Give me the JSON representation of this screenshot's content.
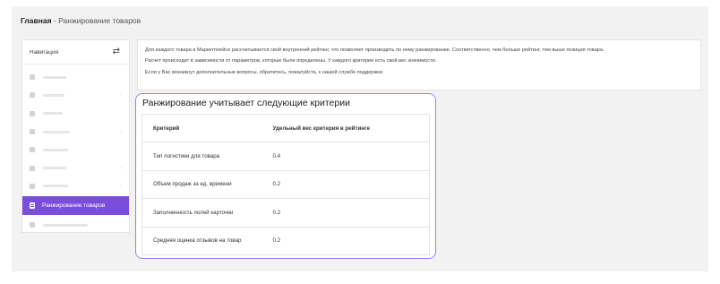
{
  "breadcrumb": {
    "home": "Главная",
    "separator": " - ",
    "current": "Ранжирование товаров"
  },
  "sidebar": {
    "title": "Навигация",
    "toggle_icon": "swap-arrows-icon",
    "items": [
      {
        "icon": "home-icon",
        "has_chevron": false,
        "active": false
      },
      {
        "icon": "box-icon",
        "has_chevron": true,
        "active": false
      },
      {
        "icon": "filter-icon",
        "has_chevron": false,
        "active": false
      },
      {
        "icon": "folder-icon",
        "has_chevron": true,
        "active": false
      },
      {
        "icon": "percent-icon",
        "has_chevron": false,
        "active": false
      },
      {
        "icon": "chart-icon",
        "has_chevron": true,
        "active": false
      },
      {
        "icon": "grid-icon",
        "has_chevron": true,
        "active": false
      },
      {
        "icon": "document-icon",
        "label": "Ранжирование товаров",
        "active": true
      },
      {
        "icon": "wrench-icon",
        "has_chevron": false,
        "active": false
      }
    ]
  },
  "info": {
    "line1": "Для каждого товара в Маркетплейсе рассчитывается свой внутренний рейтинг, что позволяет производить по нему ранжирование. Соответственно, чем больше рейтинг, тем выше позиция товара.",
    "line2": "Расчет происходит в зависимости от параметров, которые были определены. У каждого критерия есть свой вес значимости.",
    "line3": "Если у Вас возникнут дополнительные вопросы, обратитесь, пожалуйста, к нашей службе поддержки."
  },
  "criteria": {
    "title": "Ранжирование учитывает следующие критерии",
    "headers": {
      "criterion": "Критерий",
      "weight": "Удельный вес критерия в рейтинге"
    },
    "rows": [
      {
        "criterion": "Тип логистики для товара",
        "weight": "0.4"
      },
      {
        "criterion": "Объем продаж за ед. времени",
        "weight": "0.2"
      },
      {
        "criterion": "Заполненность полей карточки",
        "weight": "0.2"
      },
      {
        "criterion": "Средняя оценка отзывов на товар",
        "weight": "0.2"
      }
    ]
  },
  "colors": {
    "accent": "#7b4ddb",
    "highlight_border": "#a67de8",
    "page_bg": "#f2f2f2"
  }
}
